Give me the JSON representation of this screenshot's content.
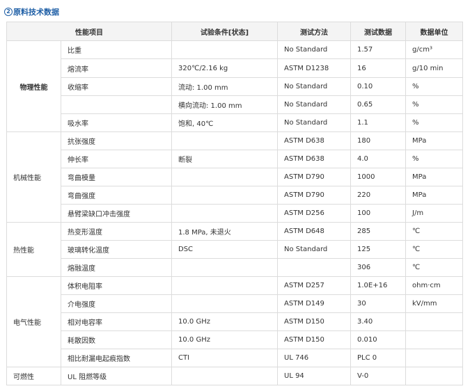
{
  "heading": {
    "number": "2",
    "title": "原料技术数据"
  },
  "columns": [
    "性能项目",
    "试验条件[状态]",
    "测试方法",
    "测试数据",
    "数据单位"
  ],
  "groups": [
    {
      "category": "物理性能",
      "rows": [
        {
          "property": "比重",
          "condition": "",
          "method": "No Standard",
          "value": "1.57",
          "unit": "g/cm³"
        },
        {
          "property": "熔流率",
          "condition": "320℃/2.16 kg",
          "method": "ASTM D1238",
          "value": "16",
          "unit": "g/10 min"
        },
        {
          "property": "收缩率",
          "condition": "流动: 1.00 mm",
          "method": "No Standard",
          "value": "0.10",
          "unit": "%"
        },
        {
          "property": "",
          "condition": "横向流动: 1.00 mm",
          "method": "No Standard",
          "value": "0.65",
          "unit": "%"
        },
        {
          "property": "吸水率",
          "condition": "饱和, 40℃",
          "method": "No Standard",
          "value": "1.1",
          "unit": "%"
        }
      ]
    },
    {
      "category": "机械性能",
      "rows": [
        {
          "property": "抗张强度",
          "condition": "",
          "method": "ASTM D638",
          "value": "180",
          "unit": "MPa"
        },
        {
          "property": "伸长率",
          "condition": "断裂",
          "method": "ASTM D638",
          "value": "4.0",
          "unit": "%"
        },
        {
          "property": "弯曲模量",
          "condition": "",
          "method": "ASTM D790",
          "value": "1000",
          "unit": "MPa"
        },
        {
          "property": "弯曲强度",
          "condition": "",
          "method": "ASTM D790",
          "value": "220",
          "unit": "MPa"
        },
        {
          "property": "悬臂梁缺口冲击强度",
          "condition": "",
          "method": "ASTM D256",
          "value": "100",
          "unit": "J/m"
        }
      ]
    },
    {
      "category": "热性能",
      "rows": [
        {
          "property": "热变形温度",
          "condition": "1.8 MPa, 未退火",
          "method": "ASTM D648",
          "value": "285",
          "unit": "℃"
        },
        {
          "property": "玻璃转化温度",
          "condition": "DSC",
          "method": "No Standard",
          "value": "125",
          "unit": "℃"
        },
        {
          "property": "熔融温度",
          "condition": "",
          "method": "",
          "value": "306",
          "unit": "℃"
        }
      ]
    },
    {
      "category": "电气性能",
      "rows": [
        {
          "property": "体积电阻率",
          "condition": "",
          "method": "ASTM D257",
          "value": "1.0E+16",
          "unit": "ohm·cm"
        },
        {
          "property": "介电强度",
          "condition": "",
          "method": "ASTM D149",
          "value": "30",
          "unit": "kV/mm"
        },
        {
          "property": "相对电容率",
          "condition": "10.0 GHz",
          "method": "ASTM D150",
          "value": "3.40",
          "unit": ""
        },
        {
          "property": "耗散因数",
          "condition": "10.0 GHz",
          "method": "ASTM D150",
          "value": "0.010",
          "unit": ""
        },
        {
          "property": "相比耐漏电起痕指数",
          "condition": "CTI",
          "method": "UL 746",
          "value": "PLC 0",
          "unit": ""
        }
      ]
    },
    {
      "category": "可燃性",
      "rows": [
        {
          "property": "UL 阻燃等级",
          "condition": "",
          "method": "UL 94",
          "value": "V-0",
          "unit": ""
        }
      ]
    }
  ]
}
